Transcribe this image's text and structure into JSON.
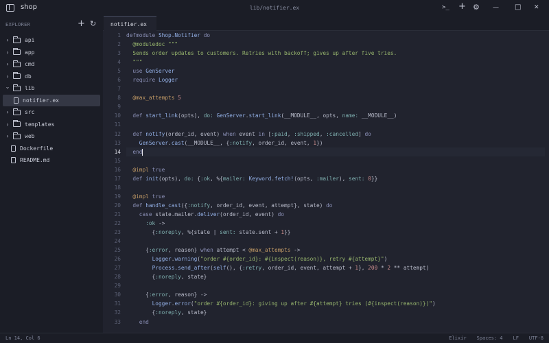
{
  "titlebar": {
    "project": "shop",
    "path": "lib/notifier.ex",
    "terminal_glyph": ">_",
    "new_glyph": "+",
    "settings_glyph": "⚙",
    "minimize_glyph": "—",
    "maximize_glyph": "□",
    "close_glyph": "✕"
  },
  "sidebar": {
    "header": "EXPLORER",
    "new_glyph": "+",
    "refresh_glyph": "↻",
    "items": [
      {
        "label": "api",
        "type": "folder",
        "expanded": false
      },
      {
        "label": "app",
        "type": "folder",
        "expanded": false
      },
      {
        "label": "cmd",
        "type": "folder",
        "expanded": false
      },
      {
        "label": "db",
        "type": "folder",
        "expanded": false
      },
      {
        "label": "lib",
        "type": "folder",
        "expanded": true
      },
      {
        "label": "notifier.ex",
        "type": "file",
        "selected": true
      },
      {
        "label": "src",
        "type": "folder",
        "expanded": false
      },
      {
        "label": "templates",
        "type": "folder",
        "expanded": false
      },
      {
        "label": "web",
        "type": "folder",
        "expanded": false
      },
      {
        "label": "Dockerfile",
        "type": "file"
      },
      {
        "label": "README.md",
        "type": "file"
      }
    ]
  },
  "tabs": [
    {
      "label": "notifier.ex",
      "active": true
    }
  ],
  "editor": {
    "current_line": 14,
    "lines": [
      "defmodule Shop.Notifier do",
      "  @moduledoc \"\"\"",
      "  Sends order updates to customers. Retries with backoff; gives up after five tries.",
      "  \"\"\"",
      "  use GenServer",
      "  require Logger",
      "",
      "  @max_attempts 5",
      "",
      "  def start_link(opts), do: GenServer.start_link(__MODULE__, opts, name: __MODULE__)",
      "",
      "  def notify(order_id, event) when event in [:paid, :shipped, :cancelled] do",
      "    GenServer.cast(__MODULE__, {:notify, order_id, event, 1})",
      "  end",
      "",
      "  @impl true",
      "  def init(opts), do: {:ok, %{mailer: Keyword.fetch!(opts, :mailer), sent: 0}}",
      "",
      "  @impl true",
      "  def handle_cast({:notify, order_id, event, attempt}, state) do",
      "    case state.mailer.deliver(order_id, event) do",
      "      :ok ->",
      "        {:noreply, %{state | sent: state.sent + 1}}",
      "",
      "      {:error, reason} when attempt < @max_attempts ->",
      "        Logger.warning(\"order #{order_id}: #{inspect(reason)}, retry #{attempt}\")",
      "        Process.send_after(self(), {:retry, order_id, event, attempt + 1}, 200 * 2 ** attempt)",
      "        {:noreply, state}",
      "",
      "      {:error, reason} ->",
      "        Logger.error(\"order #{order_id}: giving up after #{attempt} tries (#{inspect(reason)})\")",
      "        {:noreply, state}",
      "    end"
    ]
  },
  "status": {
    "cursor": "Ln 14, Col 6",
    "language": "Elixir",
    "indent": "Spaces: 4",
    "eol": "LF",
    "encoding": "UTF-8"
  },
  "colors": {
    "background": "#1b1d26",
    "editor_background": "#21232e",
    "keyword": "#8b90b7",
    "string": "#97b56d",
    "attribute": "#c39b66",
    "function": "#93b0e6",
    "atom": "#7fb0b0"
  }
}
